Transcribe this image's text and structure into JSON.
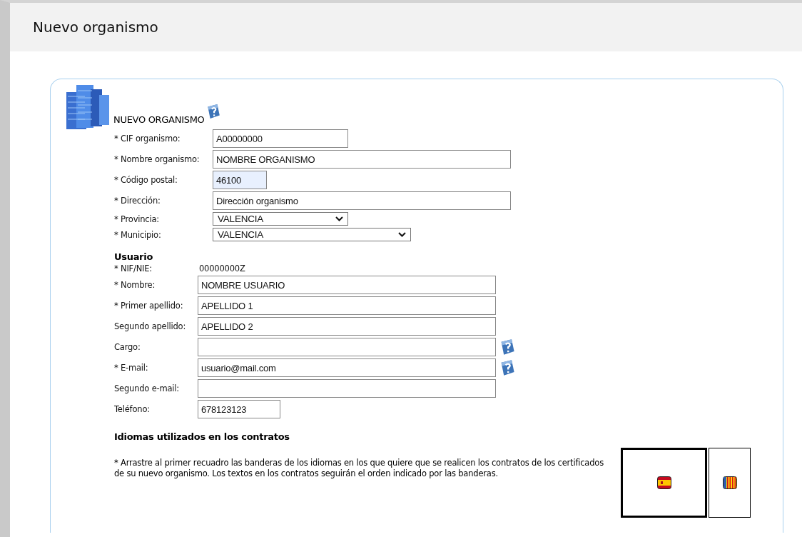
{
  "page": {
    "title": "Nuevo organismo"
  },
  "form": {
    "heading": "NUEVO ORGANISMO",
    "organization_fields": [
      {
        "label": "* CIF organismo:",
        "kind": "input",
        "value": "A00000000",
        "autofilled": false
      },
      {
        "label": "* Nombre organismo:",
        "kind": "input",
        "value": "NOMBRE ORGANISMO",
        "autofilled": false
      },
      {
        "label": "* Código postal:",
        "kind": "input",
        "value": "46100",
        "autofilled": true
      },
      {
        "label": "* Dirección:",
        "kind": "input",
        "value": "Dirección organismo",
        "autofilled": false
      },
      {
        "label": "* Provincia:",
        "kind": "select",
        "value": "VALENCIA"
      },
      {
        "label": "* Municipio:",
        "kind": "select",
        "value": "VALENCIA"
      }
    ],
    "user_heading": "Usuario",
    "user_fields": [
      {
        "label": "* NIF/NIE:",
        "kind": "text",
        "value": "00000000Z"
      },
      {
        "label": "* Nombre:",
        "kind": "input",
        "value": "NOMBRE USUARIO"
      },
      {
        "label": "* Primer apellido:",
        "kind": "input",
        "value": "APELLIDO 1"
      },
      {
        "label": "Segundo apellido:",
        "kind": "input",
        "value": "APELLIDO 2"
      },
      {
        "label": "Cargo:",
        "kind": "helpinput"
      },
      {
        "label": "* E-mail:",
        "kind": "helpinput",
        "value": "usuario@mail.com"
      },
      {
        "label": "Segundo e-mail:",
        "kind": "input"
      },
      {
        "label": "Teléfono:",
        "kind": "input",
        "value": "678123123"
      }
    ],
    "languages_heading": "Idiomas utilizados en los contratos",
    "languages_note": "* Arrastre al primer recuadro las banderas de los idiomas en los que quiere que se realicen los contratos de los certificados de su nuevo organismo. Los textos en los contratos seguirán el orden indicado por las banderas.",
    "language_boxes": [
      {
        "kind": "primary",
        "flags": [
          {
            "kind": "es"
          }
        ]
      },
      {
        "kind": "secondary",
        "flags": [
          {
            "kind": "va"
          }
        ]
      }
    ]
  }
}
